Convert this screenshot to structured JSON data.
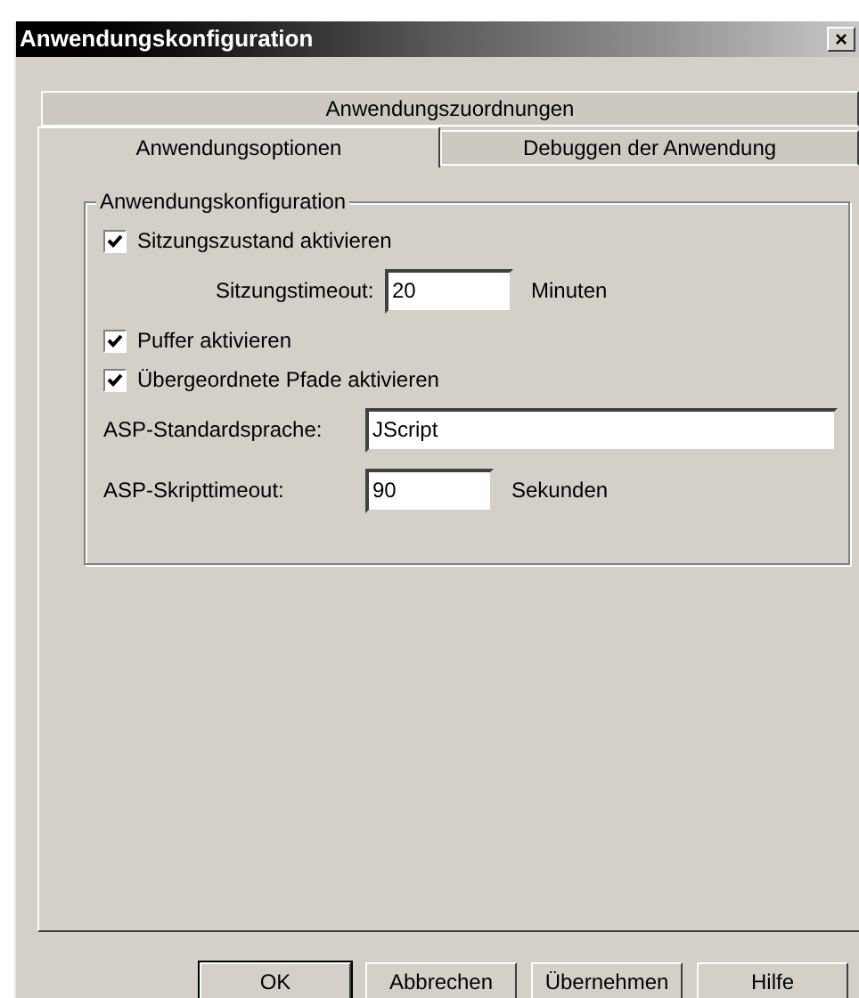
{
  "window": {
    "title": "Anwendungskonfiguration",
    "close": "×"
  },
  "tab_rows": [
    [
      {
        "label": "Anwendungszuordnungen",
        "selected": false
      }
    ],
    [
      {
        "label": "Anwendungsoptionen",
        "selected": true
      },
      {
        "label": "Debuggen der Anwendung",
        "selected": false
      }
    ]
  ],
  "group": {
    "title": "Anwendungskonfiguration",
    "rows": [
      {
        "kind": "checkbox",
        "label": "Sitzungszustand aktivieren",
        "checked": true
      },
      {
        "kind": "field",
        "label": "Sitzungstimeout:",
        "value": "20",
        "unit": "Minuten",
        "indent": true
      },
      {
        "kind": "checkbox",
        "label": "Puffer aktivieren",
        "checked": true
      },
      {
        "kind": "checkbox",
        "label": "Übergeordnete Pfade aktivieren",
        "checked": true
      },
      {
        "kind": "field",
        "label": "ASP-Standardsprache:",
        "value": "JScript",
        "wide": true
      },
      {
        "kind": "field",
        "label": "ASP-Skripttimeout:",
        "value": "90",
        "unit": "Sekunden"
      }
    ]
  },
  "buttons": [
    {
      "label": "OK",
      "default": true
    },
    {
      "label": "Abbrechen",
      "default": false
    },
    {
      "label": "Übernehmen",
      "default": false
    },
    {
      "label": "Hilfe",
      "default": false
    }
  ]
}
